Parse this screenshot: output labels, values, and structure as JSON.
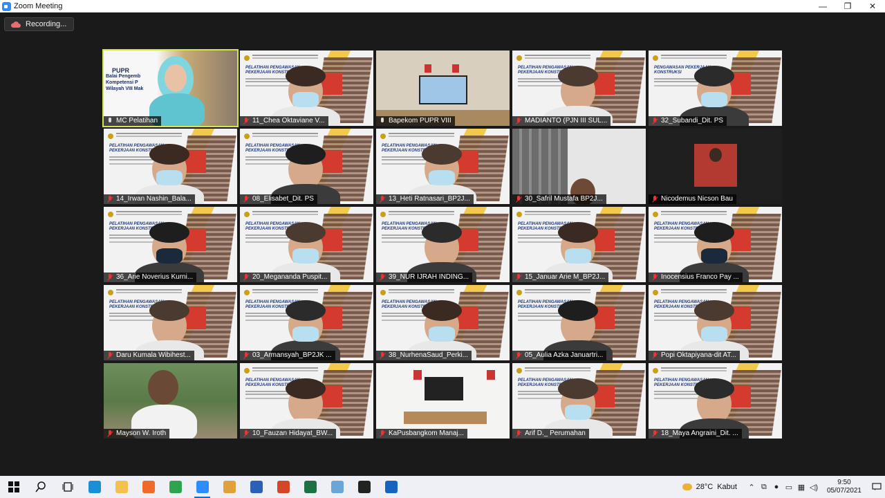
{
  "window": {
    "title": "Zoom Meeting",
    "controls": {
      "minimize": "—",
      "maximize": "❐",
      "close": "✕"
    }
  },
  "recording": {
    "label": "Recording..."
  },
  "participants": [
    {
      "name": "MC Pelatihan",
      "muted": false,
      "kind": "mc",
      "active": true,
      "mc_logo": "PUPR",
      "mc_lines": [
        "Balai Pengemb",
        "Kompetensi P",
        "Wilayah VIII Mak"
      ]
    },
    {
      "name": "11_Chea Oktaviane V...",
      "muted": true,
      "kind": "slide",
      "slide_title": "PELATIHAN PENGAWASAN PEKERJAAN KONSTRUKSI"
    },
    {
      "name": "Bapekom PUPR VIII",
      "muted": false,
      "kind": "room"
    },
    {
      "name": "MADIANTO (PJN III SUL...",
      "muted": true,
      "kind": "slide",
      "slide_title": "PELATIHAN PENGAWASAN PEKERJAAN KONSTRUKSI"
    },
    {
      "name": "32_Subandi_Dit. PS",
      "muted": true,
      "kind": "slide",
      "slide_title": "PENGAWASAN PEKERJAAN KONSTRUKSI"
    },
    {
      "name": "14_Irwan Nashin_Bala...",
      "muted": true,
      "kind": "slide",
      "slide_title": "PELATIHAN PENGAWASAN PEKERJAAN KONSTRUKSI"
    },
    {
      "name": "08_Elisabet_Dit. PS",
      "muted": true,
      "kind": "slide",
      "slide_title": "PELATIHAN PENGAWASAN PEKERJAAN KONSTRUKSI"
    },
    {
      "name": "13_Heti Ratnasari_BP2J...",
      "muted": true,
      "kind": "slide",
      "slide_title": "PELATIHAN PENGAWASAN PEKERJAAN KONSTRUKSI"
    },
    {
      "name": "30_Safril Mustafa BP2J...",
      "muted": true,
      "kind": "office"
    },
    {
      "name": "Nicodemus Nicson Bau",
      "muted": true,
      "kind": "photo"
    },
    {
      "name": "36_Arie Noverius Kurni...",
      "muted": true,
      "kind": "slide",
      "slide_title": "PELATIHAN PENGAWASAN PEKERJAAN KONSTRUKSI"
    },
    {
      "name": "20_Megananda Puspit...",
      "muted": true,
      "kind": "slide",
      "slide_title": "PELATIHAN PENGAWASAN PEKERJAAN KONSTRUKSI"
    },
    {
      "name": "39_NUR IJRAH INDING...",
      "muted": true,
      "kind": "slide",
      "slide_title": "PELATIHAN PENGAWASAN PEKERJAAN KONSTRUKSI"
    },
    {
      "name": "15_Januar Arie M_BP2J...",
      "muted": true,
      "kind": "slide",
      "slide_title": "PELATIHAN PENGAWASAN PEKERJAAN KONSTRUKSI"
    },
    {
      "name": "Inocensius Franco Pay ...",
      "muted": true,
      "kind": "slide",
      "slide_title": "PELATIHAN PENGAWASAN PEKERJAAN KONSTRUKSI"
    },
    {
      "name": "Daru Kumala Wibihest...",
      "muted": true,
      "kind": "slide",
      "slide_title": "PELATIHAN PENGAWASAN PEKERJAAN KONSTRUKSI"
    },
    {
      "name": "03_Armansyah_BP2JK ...",
      "muted": true,
      "kind": "slide",
      "slide_title": "PELATIHAN PENGAWASAN PEKERJAAN KONSTRUKSI"
    },
    {
      "name": "38_NurhenaSaud_Perki...",
      "muted": true,
      "kind": "slide",
      "slide_title": "PELATIHAN PENGAWASAN PEKERJAAN KONSTRUKSI"
    },
    {
      "name": "05_Aulia Azka Januartri...",
      "muted": true,
      "kind": "slide",
      "slide_title": "PELATIHAN PENGAWASAN PEKERJAAN KONSTRUKSI"
    },
    {
      "name": "Popi Oktapiyana-dit AT...",
      "muted": true,
      "kind": "slide",
      "slide_title": "PELATIHAN PENGAWASAN PEKERJAAN KONSTRUKSI"
    },
    {
      "name": "Mayson W. Iroth",
      "muted": true,
      "kind": "outdoor"
    },
    {
      "name": "10_Fauzan Hidayat_BW...",
      "muted": true,
      "kind": "slide",
      "slide_title": "PELATIHAN PENGAWASAN PEKERJAAN KONSTRUKSI"
    },
    {
      "name": "KaPusbangkom Manaj...",
      "muted": true,
      "kind": "room2"
    },
    {
      "name": "Arif D._ Perumahan",
      "muted": true,
      "kind": "slide",
      "slide_title": "PELATIHAN PENGAWASAN PEKERJAAN KONSTRUKSI"
    },
    {
      "name": "18_Maya Angraini_Dit. ...",
      "muted": true,
      "kind": "slide",
      "slide_title": "PELATIHAN PENGAWASAN PEKERJAAN KONSTRUKSI"
    }
  ],
  "taskbar": {
    "apps": [
      {
        "name": "windows-start-icon",
        "color": "#1f1f1f"
      },
      {
        "name": "search-icon",
        "color": "#1f1f1f"
      },
      {
        "name": "task-view-icon",
        "color": "#1f1f1f"
      },
      {
        "name": "edge-icon",
        "color": "#1b8fd6"
      },
      {
        "name": "file-explorer-icon",
        "color": "#f2c14e"
      },
      {
        "name": "firefox-icon",
        "color": "#f06a2a"
      },
      {
        "name": "chrome-icon",
        "color": "#2ea44f"
      },
      {
        "name": "zoom-icon",
        "color": "#2d8cff"
      },
      {
        "name": "media-player-icon",
        "color": "#e0a13a"
      },
      {
        "name": "word-icon",
        "color": "#2b5fb8"
      },
      {
        "name": "powerpoint-icon",
        "color": "#d24726"
      },
      {
        "name": "excel-icon",
        "color": "#1e7145"
      },
      {
        "name": "paint-icon",
        "color": "#6aa6d8"
      },
      {
        "name": "terminal-icon",
        "color": "#222222"
      },
      {
        "name": "presentation-app-icon",
        "color": "#1565c0"
      }
    ],
    "weather": {
      "temp": "28°C",
      "condition": "Kabut"
    },
    "tray_icons": [
      "chevron-up-icon",
      "meet-now-icon",
      "microphone-icon",
      "usb-icon",
      "network-icon",
      "volume-icon"
    ],
    "clock": {
      "time": "9:50",
      "date": "05/07/2021"
    }
  }
}
